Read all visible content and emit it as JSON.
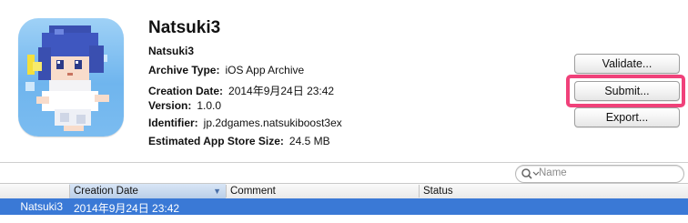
{
  "archive": {
    "name": "Natsuki3",
    "details": [
      {
        "label": "Natsuki3",
        "value": ""
      },
      {
        "label": "Archive Type:",
        "value": "iOS App Archive"
      },
      {
        "label": "Creation Date:",
        "value": "2014年9月24日 23:42"
      },
      {
        "label": "Version:",
        "value": "1.0.0"
      },
      {
        "label": "Identifier:",
        "value": "jp.2dgames.natsukiboost3ex"
      },
      {
        "label": "Estimated App Store Size:",
        "value": "24.5 MB"
      }
    ]
  },
  "actions": {
    "validate": "Validate...",
    "submit": "Submit...",
    "export": "Export..."
  },
  "colors": {
    "highlight": "#f0417a",
    "selection": "#3a79d6"
  },
  "search": {
    "placeholder": "Name"
  },
  "table": {
    "columns": [
      "Creation Date",
      "Comment",
      "Status"
    ],
    "rows": [
      {
        "name": "Natsuki3",
        "date": "2014年9月24日 23:42",
        "comment": "",
        "status": ""
      }
    ]
  }
}
